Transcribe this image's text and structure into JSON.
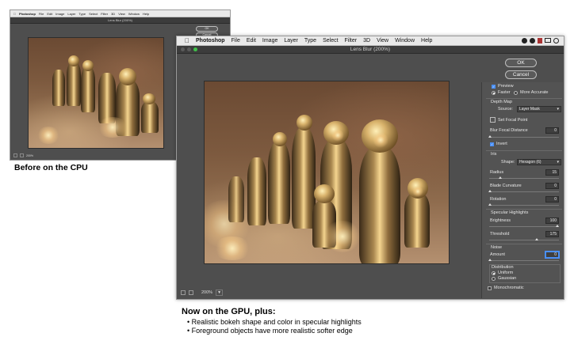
{
  "cpu": {
    "app_name": "Photoshop",
    "menu": [
      "File",
      "Edit",
      "Image",
      "Layer",
      "Type",
      "Select",
      "Filter",
      "3D",
      "View",
      "Window",
      "Help"
    ],
    "title": "Lens Blur (200%)",
    "ok_label": "OK",
    "cancel_label": "Cancel",
    "zoom": "200%",
    "caption": "Before on the CPU"
  },
  "gpu": {
    "app_name": "Photoshop",
    "menu": [
      "File",
      "Edit",
      "Image",
      "Layer",
      "Type",
      "Select",
      "Filter",
      "3D",
      "View",
      "Window",
      "Help"
    ],
    "title": "Lens Blur (200%)",
    "ok_label": "OK",
    "cancel_label": "Cancel",
    "zoom": "200%",
    "panel": {
      "preview_label": "Preview",
      "faster_label": "Faster",
      "more_accurate_label": "More Accurate",
      "depth_map_title": "Depth Map",
      "source_label": "Source:",
      "source_value": "Layer Mask",
      "set_focal_point_label": "Set Focal Point",
      "blur_focal_distance_label": "Blur Focal Distance",
      "blur_focal_distance_value": "0",
      "invert_label": "Invert",
      "iris_title": "Iris",
      "shape_label": "Shape:",
      "shape_value": "Hexagon (6)",
      "radius_label": "Radius",
      "radius_value": "15",
      "blade_curvature_label": "Blade Curvature",
      "blade_curvature_value": "0",
      "rotation_label": "Rotation",
      "rotation_value": "0",
      "specular_title": "Specular Highlights",
      "brightness_label": "Brightness",
      "brightness_value": "100",
      "threshold_label": "Threshold",
      "threshold_value": "175",
      "noise_title": "Noise",
      "amount_label": "Amount",
      "amount_value": "0",
      "distribution_title": "Distribution",
      "uniform_label": "Uniform",
      "gaussian_label": "Gaussian",
      "monochromatic_label": "Monochromatic"
    },
    "caption_heading": "Now on the GPU, plus:",
    "bullets": [
      "Realistic bokeh shape and color in specular highlights",
      "Foreground objects have more realistic softer edge"
    ]
  },
  "colors": {
    "accent": "#4a8ff5",
    "dialog_bg": "#4e4e4e",
    "panel_bg": "#535353"
  }
}
